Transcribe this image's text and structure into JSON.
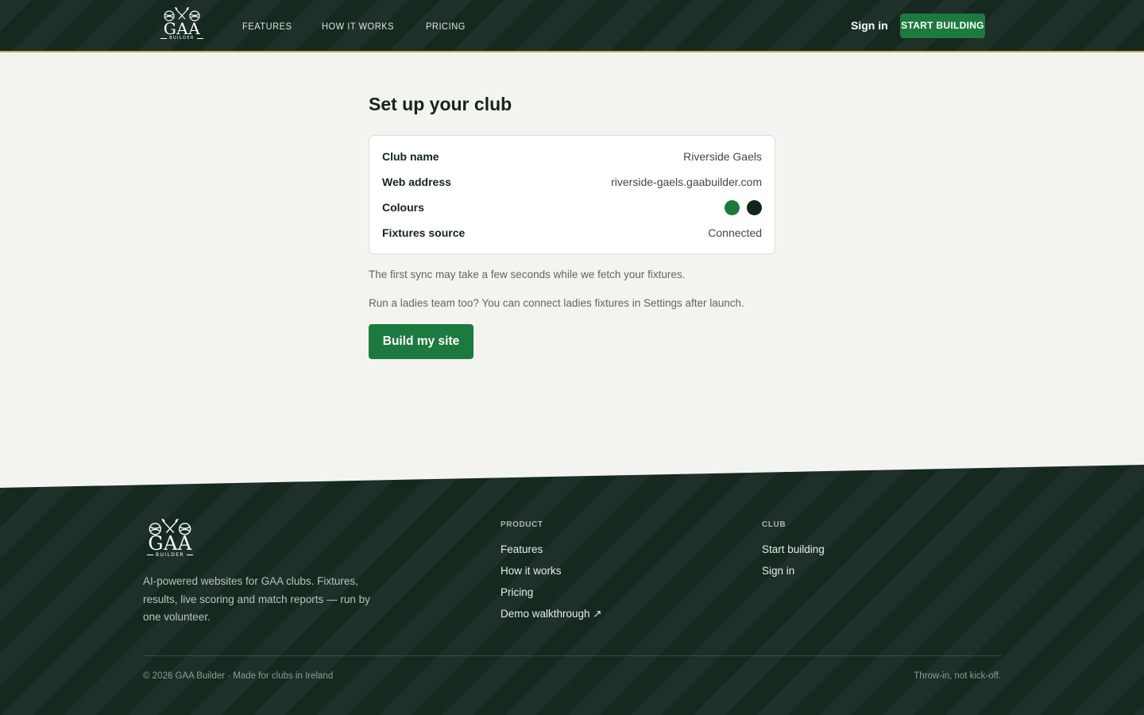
{
  "header": {
    "logo": {
      "word": "GAA",
      "sub": "BUILDER",
      "icon": "hurley-sliotar-crest-icon"
    },
    "nav": [
      "FEATURES",
      "HOW IT WORKS",
      "PRICING"
    ],
    "sign_in": "Sign in",
    "cta": "START BUILDING"
  },
  "main": {
    "title": "Set up your club",
    "summary": {
      "club_name": {
        "label": "Club name",
        "value": "Riverside Gaels"
      },
      "web_address": {
        "label": "Web address",
        "value": "riverside-gaels.gaabuilder.com"
      },
      "colours": {
        "label": "Colours",
        "values": [
          "#1d7a3f",
          "#14241a"
        ]
      },
      "fixtures_source": {
        "label": "Fixtures source",
        "value": "Connected"
      }
    },
    "sync_note": "The first sync may take a few seconds while we fetch your fixtures.",
    "ladies_note": "Run a ladies team too? You can connect ladies fixtures in Settings after launch.",
    "build_button": "Build my site"
  },
  "footer": {
    "logo": {
      "word": "GAA",
      "sub": "BUILDER"
    },
    "description": "AI-powered websites for GAA clubs. Fixtures, results, live scoring and match reports — run by one volunteer.",
    "product": {
      "heading": "PRODUCT",
      "links": [
        "Features",
        "How it works",
        "Pricing",
        "Demo walkthrough ↗"
      ]
    },
    "club": {
      "heading": "CLUB",
      "links": [
        "Start building",
        "Sign in"
      ]
    },
    "copyright": "© 2026 GAA Builder · Made for clubs in Ireland",
    "tagline": "Throw-in, not kick-off."
  },
  "colors": {
    "brand_green": "#1d7a3f",
    "dark": "#16291f",
    "gold_rule": "#c9a94a",
    "page_bg": "#f3f4f0"
  }
}
